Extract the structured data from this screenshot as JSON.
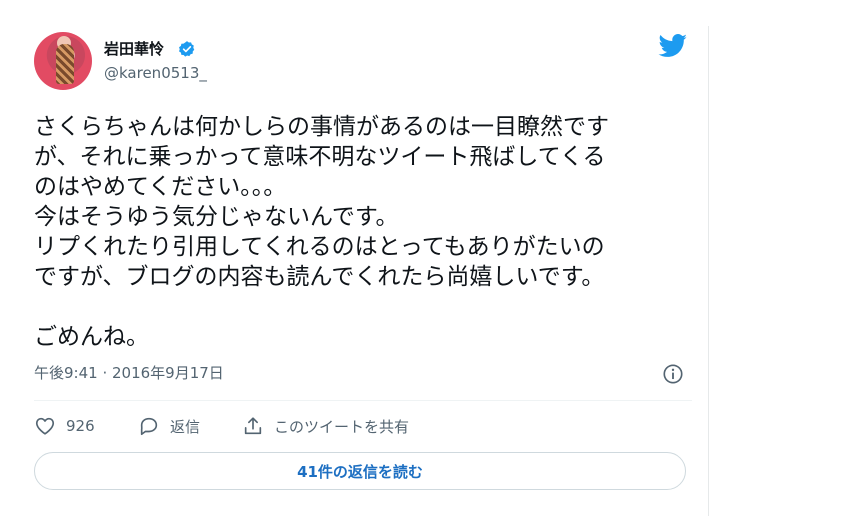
{
  "tweet": {
    "author_name": "岩田華怜",
    "author_handle": "@karen0513_",
    "text": "さくらちゃんは何かしらの事情があるのは一目瞭然です\nが、それに乗っかって意味不明なツイート飛ばしてくる\nのはやめてください。。。\n今はそうゆう気分じゃないんです。\nリプくれたり引用してくれるのはとってもありがたいの\nですが、ブログの内容も読んでくれたら尚嬉しいです。\n\nごめんね。",
    "timestamp": "午後9:41 · 2016年9月17日",
    "like_count": "926",
    "reply_label": "返信",
    "share_label": "このツイートを共有",
    "read_replies_label": "41件の返信を読む"
  },
  "colors": {
    "brand": "#1d9bf0",
    "link": "#1d6fc2",
    "secondary_text": "#536471"
  },
  "icons": {
    "verified": "verified-badge-icon",
    "brand": "twitter-bird-icon",
    "info": "info-icon",
    "like": "heart-icon",
    "reply": "reply-bubble-icon",
    "share": "share-upload-icon"
  }
}
